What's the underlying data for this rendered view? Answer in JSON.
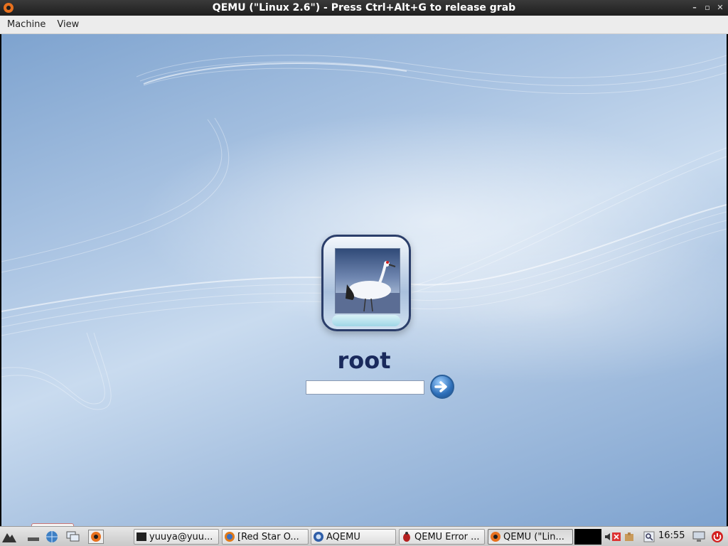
{
  "window": {
    "title": "QEMU (\"Linux 2.6\") - Press Ctrl+Alt+G to release grab",
    "buttons": [
      "minimize",
      "maximize",
      "close"
    ]
  },
  "menubar": {
    "items": [
      "Machine",
      "View"
    ]
  },
  "login": {
    "username": "root",
    "password_value": "",
    "avatar": "red-crowned-crane-photo",
    "submit_icon": "arrow-right-icon"
  },
  "taskbar": {
    "launchers": [
      "start-menu-icon",
      "show-desktop-icon",
      "globe-icon",
      "windows-icon",
      "qemu-icon"
    ],
    "tasks": [
      {
        "label": "yuuya@yuu...",
        "icon": "terminal-icon"
      },
      {
        "label": "[Red Star O...",
        "icon": "browser-icon"
      },
      {
        "label": "AQEMU",
        "icon": "aqemu-icon"
      },
      {
        "label": "QEMU Error ...",
        "icon": "bug-icon"
      },
      {
        "label": "QEMU (\"Lin...",
        "icon": "qemu-icon",
        "active": true
      }
    ],
    "clock": "16:55",
    "tray_icons": [
      "volume-icon",
      "close-red-icon",
      "package-icon",
      "search-icon",
      "display-icon",
      "power-icon"
    ],
    "colors": {
      "power": "#d32020",
      "accent": "#2e6fb9"
    }
  }
}
